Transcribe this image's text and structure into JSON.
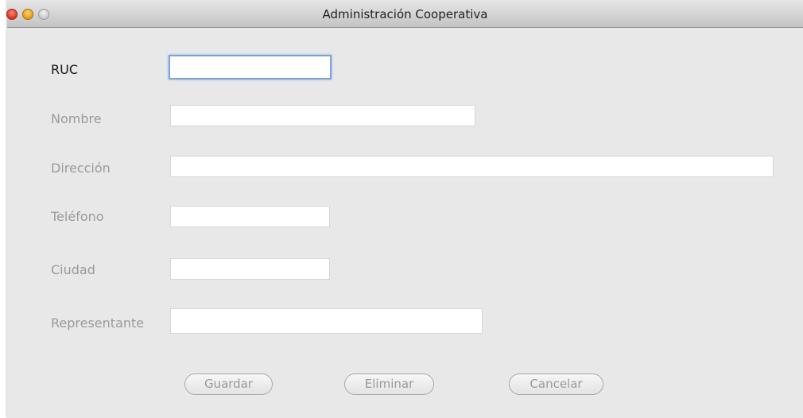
{
  "window": {
    "title": "Administración Cooperativa",
    "controls": [
      "close-icon",
      "minimize-icon",
      "zoom-icon"
    ]
  },
  "form": {
    "ruc": {
      "label": "RUC",
      "value": ""
    },
    "nombre": {
      "label": "Nombre",
      "value": ""
    },
    "direccion": {
      "label": "Dirección",
      "value": ""
    },
    "telefono": {
      "label": "Teléfono",
      "value": ""
    },
    "ciudad": {
      "label": "Ciudad",
      "value": ""
    },
    "representante": {
      "label": "Representante",
      "value": ""
    }
  },
  "buttons": {
    "guardar": "Guardar",
    "eliminar": "Eliminar",
    "cancelar": "Cancelar"
  }
}
